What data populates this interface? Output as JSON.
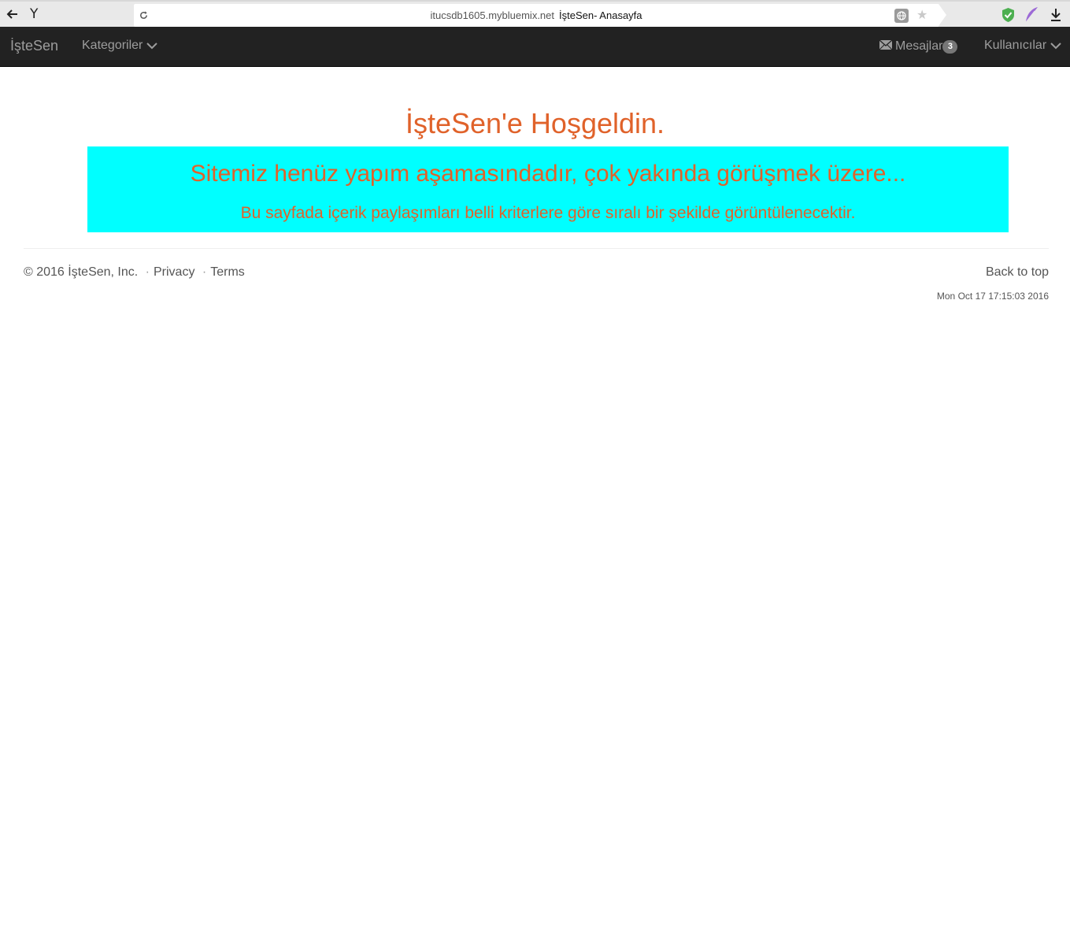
{
  "browser": {
    "url_domain": "itucsdb1605.mybluemix.net",
    "page_title": "İşteSen- Anasayfa",
    "browser_logo": "Y"
  },
  "navbar": {
    "brand": "İşteSen",
    "categories_label": "Kategoriler",
    "messages_label": "Mesajlar",
    "messages_badge": "3",
    "users_label": "Kullanıcılar"
  },
  "main": {
    "welcome_heading": "İşteSen'e Hoşgeldin.",
    "jumbotron_heading": "Sitemiz henüz yapım aşamasındadır, çok yakında görüşmek üzere...",
    "jumbotron_text": "Bu sayfada içerik paylaşımları belli kriterlere göre sıralı bir şekilde görüntülenecektir."
  },
  "footer": {
    "copyright": "© 2016 İşteSen, Inc.",
    "separator": "·",
    "privacy_label": "Privacy",
    "terms_label": "Terms",
    "back_to_top_label": "Back to top",
    "timestamp": "Mon Oct 17 17:15:03 2016"
  },
  "icons": {
    "back": "back-arrow-icon",
    "reload": "reload-icon",
    "translate": "translate-icon",
    "bookmark": "star-icon",
    "extension_1": "shield-icon",
    "extension_2": "feather-icon",
    "downloads": "download-icon",
    "dropdown": "chevron-down-icon",
    "messages": "envelope-icon"
  },
  "colors": {
    "navbar_bg": "#222222",
    "navbar_text": "#9d9d9d",
    "accent_orange": "#e0622a",
    "jumbotron_bg": "#00ffff",
    "badge_bg": "#777777",
    "footer_text": "#555555"
  }
}
